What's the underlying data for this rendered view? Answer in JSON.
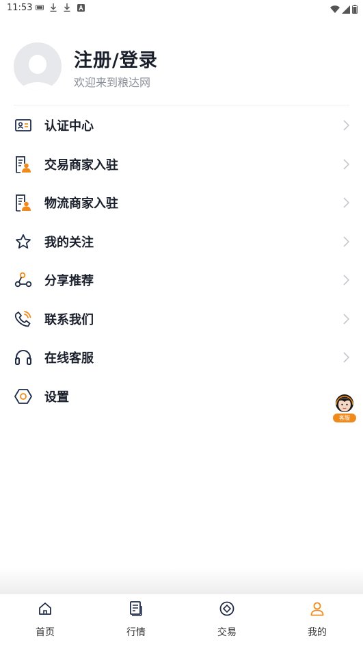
{
  "status_bar": {
    "time": "11:53",
    "left_icons": [
      "sim-icon",
      "download-icon",
      "download-icon",
      "font-icon"
    ],
    "right_icons": [
      "wifi-icon",
      "signal-icon",
      "battery-icon"
    ]
  },
  "profile": {
    "name": "注册/登录",
    "subtitle": "欢迎来到粮达网"
  },
  "menu": {
    "items": [
      {
        "label": "认证中心",
        "icon": "id-card-icon"
      },
      {
        "label": "交易商家入驻",
        "icon": "merchant-doc-icon"
      },
      {
        "label": "物流商家入驻",
        "icon": "merchant-doc-icon"
      },
      {
        "label": "我的关注",
        "icon": "star-icon"
      },
      {
        "label": "分享推荐",
        "icon": "share-icon"
      },
      {
        "label": "联系我们",
        "icon": "phone-icon"
      },
      {
        "label": "在线客服",
        "icon": "headset-icon"
      },
      {
        "label": "设置",
        "icon": "hexagon-settings-icon"
      }
    ]
  },
  "float_service": {
    "label": "客服"
  },
  "tabbar": {
    "tabs": [
      {
        "label": "首页",
        "icon": "home-icon"
      },
      {
        "label": "行情",
        "icon": "news-icon"
      },
      {
        "label": "交易",
        "icon": "trade-icon"
      },
      {
        "label": "我的",
        "icon": "user-icon"
      }
    ],
    "active_index": 3
  },
  "colors": {
    "accent": "#f08a1c",
    "icon_dark": "#1e2a45",
    "text_main": "#1a1f2c",
    "text_sub": "#8a8f99"
  }
}
